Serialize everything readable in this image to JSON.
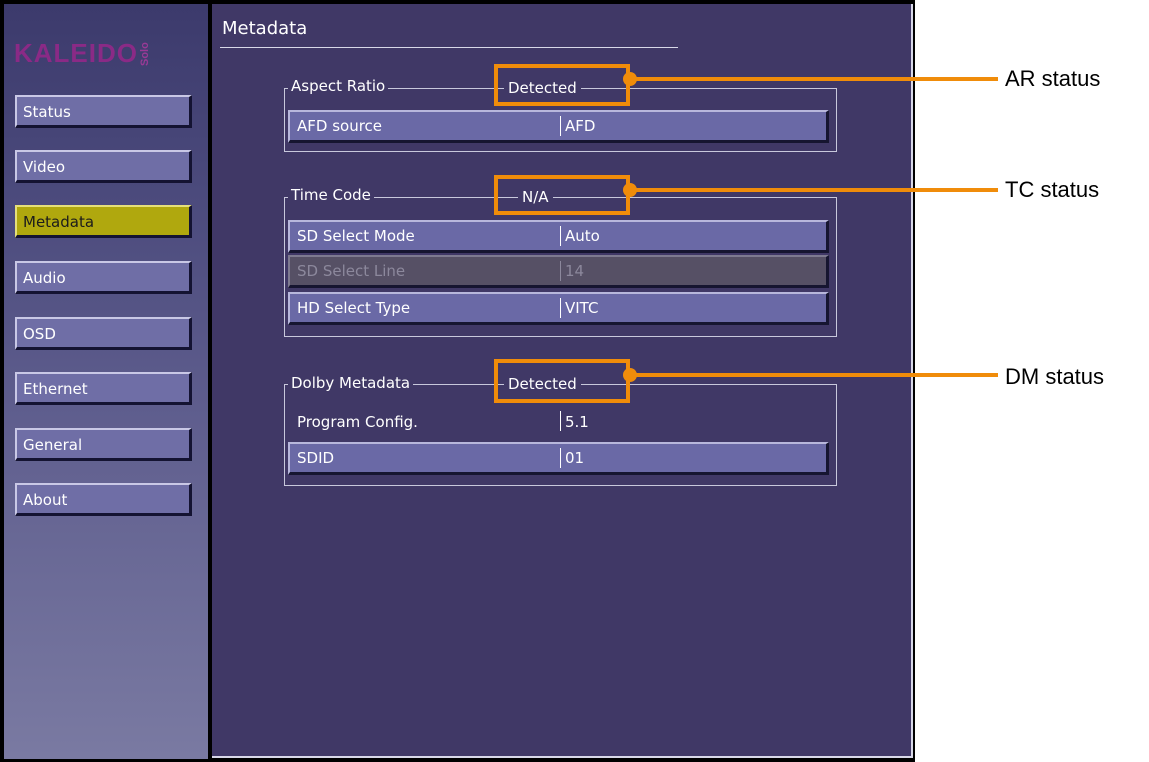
{
  "logo": {
    "brand": "KALEIDO",
    "edition": "Solo"
  },
  "nav": {
    "items": [
      {
        "label": "Status",
        "active": false
      },
      {
        "label": "Video",
        "active": false
      },
      {
        "label": "Metadata",
        "active": true
      },
      {
        "label": "Audio",
        "active": false
      },
      {
        "label": "OSD",
        "active": false
      },
      {
        "label": "Ethernet",
        "active": false
      },
      {
        "label": "General",
        "active": false
      },
      {
        "label": "About",
        "active": false
      }
    ]
  },
  "page": {
    "title": "Metadata"
  },
  "aspect_ratio": {
    "legend": "Aspect Ratio",
    "status": "Detected",
    "rows": [
      {
        "label": "AFD source",
        "value": "AFD",
        "enabled": true
      }
    ]
  },
  "time_code": {
    "legend": "Time Code",
    "status": "N/A",
    "rows": [
      {
        "label": "SD Select Mode",
        "value": "Auto",
        "enabled": true
      },
      {
        "label": "SD Select Line",
        "value": "14",
        "enabled": false
      },
      {
        "label": "HD Select Type",
        "value": "VITC",
        "enabled": true
      }
    ]
  },
  "dolby_metadata": {
    "legend": "Dolby Metadata",
    "status": "Detected",
    "program_config": {
      "label": "Program Config.",
      "value": "5.1"
    },
    "rows": [
      {
        "label": "SDID",
        "value": "01",
        "enabled": true
      }
    ]
  },
  "callouts": {
    "ar": "AR status",
    "tc": "TC status",
    "dm": "DM status"
  },
  "colors": {
    "highlight": "#f08c0a",
    "panel_bg": "#403866",
    "active_nav": "#b0a80e",
    "row_bg": "#6a69a6",
    "disabled_row_bg": "#565065"
  }
}
